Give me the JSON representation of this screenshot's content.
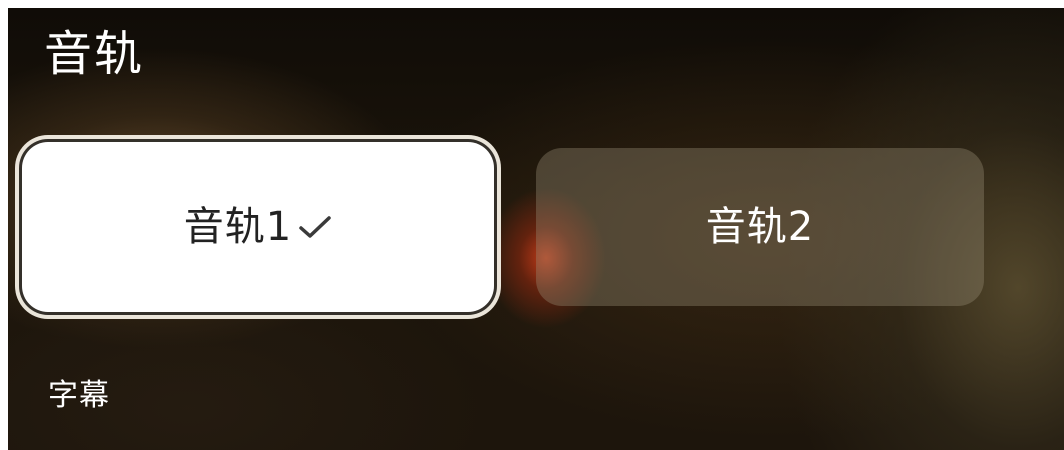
{
  "audio_section": {
    "title": "音轨",
    "tracks": [
      {
        "label": "音轨1",
        "selected": true
      },
      {
        "label": "音轨2",
        "selected": false
      }
    ]
  },
  "subtitle_section": {
    "title": "字幕"
  },
  "icons": {
    "selected_marker": "checkmark-icon"
  },
  "colors": {
    "selected_bg": "#ffffff",
    "selected_text": "#222222",
    "unselected_bg": "#6e6554",
    "text_light": "#ffffff"
  }
}
